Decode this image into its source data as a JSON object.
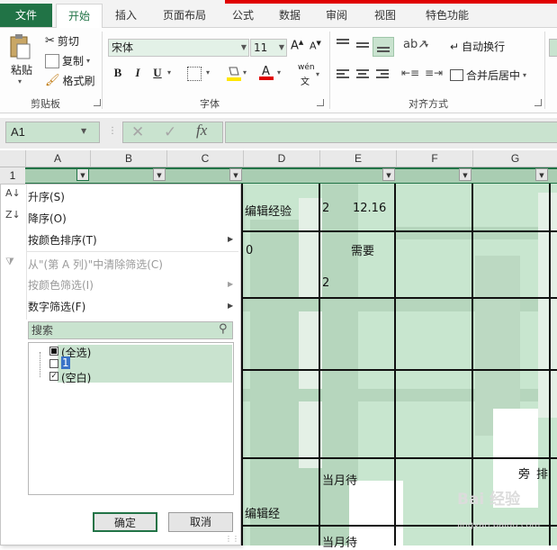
{
  "ribbon": {
    "tabs": [
      "文件",
      "开始",
      "插入",
      "页面布局",
      "公式",
      "数据",
      "审阅",
      "视图",
      "特色功能"
    ],
    "clipboard": {
      "paste": "粘贴",
      "cut": "剪切",
      "copy": "复制",
      "format_painter": "格式刷",
      "label": "剪贴板"
    },
    "font": {
      "name": "宋体",
      "size": "11",
      "label": "字体",
      "bold": "B",
      "italic": "I",
      "underline": "U",
      "phonetic": "wén"
    },
    "alignment": {
      "wrap_text": "自动换行",
      "merge_center": "合并后居中",
      "label": "对齐方式"
    }
  },
  "formula_bar": {
    "name_box": "A1",
    "fx": "fx",
    "cancel": "✕",
    "enter": "✓"
  },
  "columns": [
    "A",
    "B",
    "C",
    "D",
    "E",
    "F",
    "G"
  ],
  "row_number": "1",
  "sheet_text": {
    "t1": "编辑经验",
    "t2": "2",
    "t3": "12.16",
    "t4": "0",
    "t5": "需要",
    "t6": "2",
    "t7": "当月待",
    "t8": "编辑经",
    "t9": "当月待",
    "t10": "旁",
    "t11": "排"
  },
  "filter_menu": {
    "sort_asc": "升序(S)",
    "sort_desc": "降序(O)",
    "sort_by_color": "按颜色排序(T)",
    "clear_filter": "从\"(第 A 列)\"中清除筛选(C)",
    "filter_by_color": "按颜色筛选(I)",
    "number_filter": "数字筛选(F)",
    "search_placeholder": "搜索",
    "items": [
      {
        "label": "(全选)",
        "state": "partial"
      },
      {
        "label": "1",
        "state": "unchecked"
      },
      {
        "label": "(空白)",
        "state": "checked"
      }
    ],
    "ok": "确定",
    "cancel": "取消"
  },
  "watermark": {
    "brand": "Bai 经验",
    "url": "jingyan.baidu.com"
  },
  "colors": {
    "excel_green": "#217346",
    "highlight": "#c9e3cf",
    "sheet_bg": "#c8e6cf",
    "red_bar": "#e00000"
  }
}
